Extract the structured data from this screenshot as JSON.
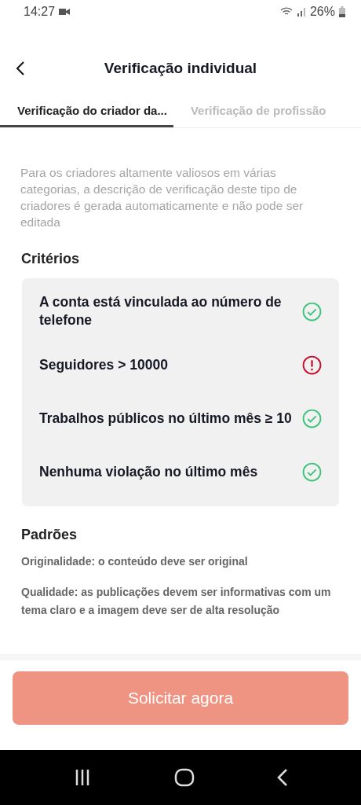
{
  "status_bar": {
    "time": "14:27",
    "battery": "26%"
  },
  "header": {
    "title": "Verificação individual"
  },
  "tabs": [
    {
      "label": "Verificação do criador da...",
      "selected": true
    },
    {
      "label": "Verificação de profissão",
      "selected": false
    }
  ],
  "description": "Para os criadores altamente valiosos em várias categorias, a descrição de verificação deste tipo de criadores é gerada automaticamente e não pode ser editada",
  "criteria": {
    "title": "Critérios",
    "items": [
      {
        "label": "A conta está vinculada ao número de telefone",
        "met": true
      },
      {
        "label": "Seguidores > 10000",
        "met": false
      },
      {
        "label": "Trabalhos públicos no último mês ≥ 10",
        "met": true
      },
      {
        "label": "Nenhuma violação no último mês",
        "met": true
      }
    ]
  },
  "standards": {
    "title": "Padrões",
    "items": [
      "Originalidade: o conteúdo deve ser original",
      "Qualidade: as publicações devem ser informativas com um tema claro e a imagem deve ser de alta resolução"
    ]
  },
  "apply_button": {
    "label": "Solicitar agora",
    "disabled": true
  }
}
